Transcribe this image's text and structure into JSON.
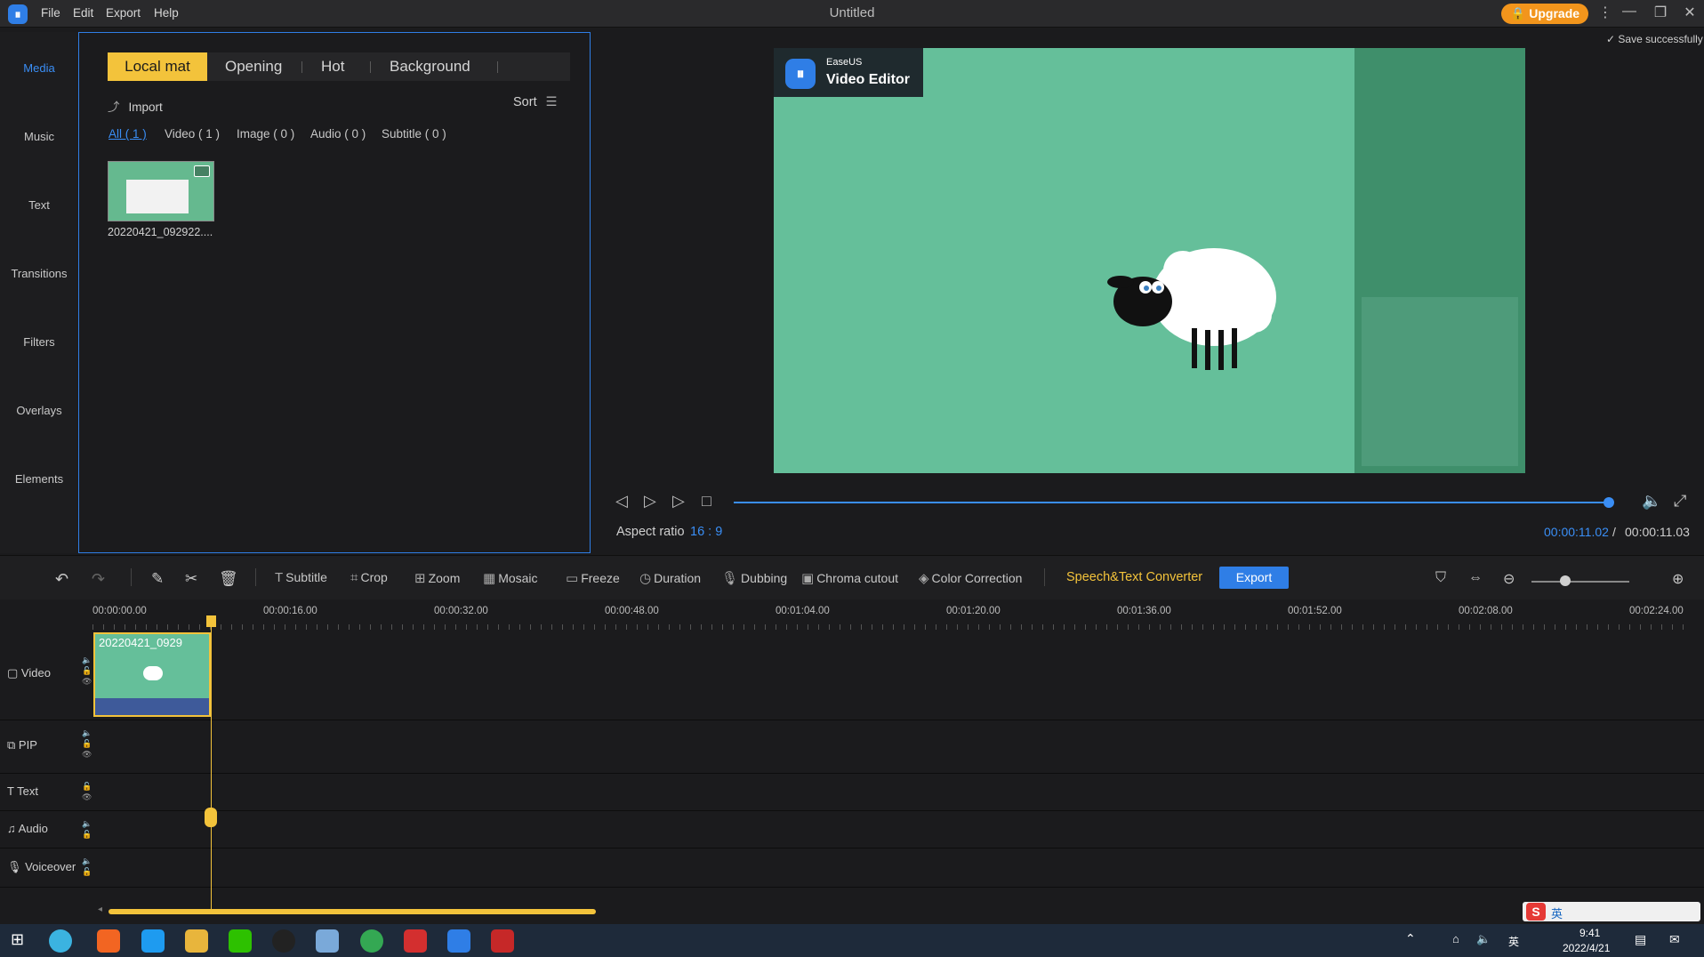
{
  "titlebar": {
    "app_icon": "easeus-logo-icon",
    "menu": [
      "File",
      "Edit",
      "Export",
      "Help"
    ],
    "title": "Untitled",
    "upgrade": "Upgrade"
  },
  "left_nav": [
    "Media",
    "Music",
    "Text",
    "Transitions",
    "Filters",
    "Overlays",
    "Elements"
  ],
  "media_panel": {
    "tabs": [
      "Local mat",
      "Opening",
      "Hot",
      "Background"
    ],
    "import_label": "Import",
    "sort_label": "Sort",
    "filters": [
      "All ( 1 )",
      "Video ( 1 )",
      "Image ( 0 )",
      "Audio ( 0 )",
      "Subtitle ( 0 )"
    ],
    "items": [
      {
        "name": "20220421_092922...."
      }
    ]
  },
  "preview": {
    "save_status": "Save successfully",
    "watermark_brand": "EaseUS",
    "watermark_product": "Video Editor",
    "aspect_label": "Aspect ratio",
    "aspect_value": "16 : 9",
    "time_current": "00:00:11.02",
    "time_separator": "/",
    "time_total": "00:00:11.03",
    "playback_progress": 1.0
  },
  "toolbar": {
    "tools": [
      "Subtitle",
      "Crop",
      "Zoom",
      "Mosaic",
      "Freeze",
      "Duration",
      "Dubbing",
      "Chroma cutout",
      "Color Correction"
    ],
    "speech_converter": "Speech&Text Converter",
    "export": "Export"
  },
  "timeline": {
    "ruler": [
      "00:00:00.00",
      "00:00:16.00",
      "00:00:32.00",
      "00:00:48.00",
      "00:01:04.00",
      "00:01:20.00",
      "00:01:36.00",
      "00:01:52.00",
      "00:02:08.00",
      "00:02:24.00"
    ],
    "tracks": [
      "Video",
      "PIP",
      "Text",
      "Audio",
      "Voiceover"
    ],
    "clip_name": "20220421_0929"
  },
  "taskbar": {
    "ime": "英",
    "lang": "英",
    "time": "9:41",
    "date": "2022/4/21"
  },
  "colors": {
    "accent_blue": "#2f7ee6",
    "accent_yellow": "#f3c33b",
    "upgrade_orange": "#f2951c",
    "video_green": "#65bf9a"
  }
}
